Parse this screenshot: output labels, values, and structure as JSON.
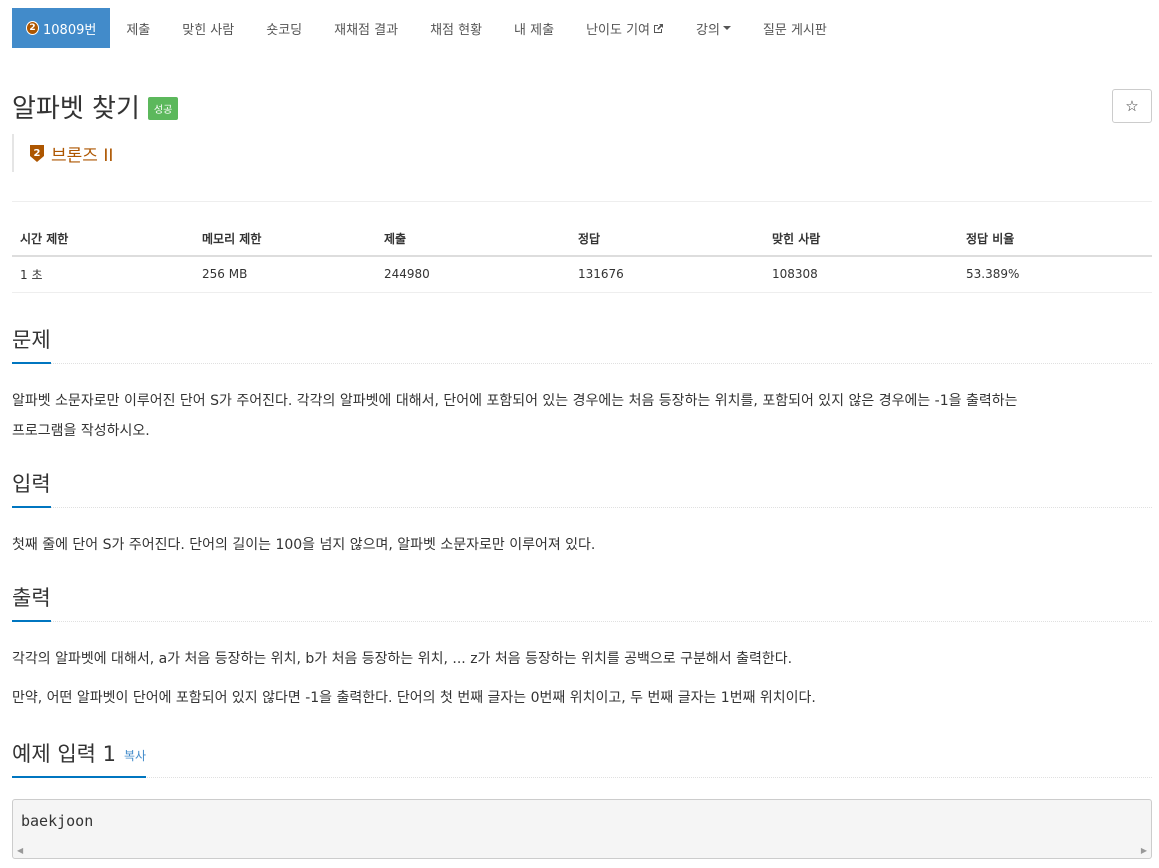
{
  "nav": {
    "problem_tab": {
      "tier": "2",
      "label": "10809번"
    },
    "items": [
      "제출",
      "맞힌 사람",
      "숏코딩",
      "재채점 결과",
      "채점 현황",
      "내 제출",
      "난이도 기여",
      "강의",
      "질문 게시판"
    ]
  },
  "problem": {
    "title": "알파벳 찾기",
    "status": "성공",
    "star": "☆",
    "tier_number": "2",
    "tier_label": "브론즈 II"
  },
  "info_table": {
    "headers": [
      "시간 제한",
      "메모리 제한",
      "제출",
      "정답",
      "맞힌 사람",
      "정답 비율"
    ],
    "row": [
      "1 초",
      "256 MB",
      "244980",
      "131676",
      "108308",
      "53.389%"
    ]
  },
  "sections": {
    "problem_title": "문제",
    "problem_text_1": "알파벳 소문자로만 이루어진 단어 S가 주어진다. 각각의 알파벳에 대해서, 단어에 포함되어 있는 경우에는 처음 등장하는 위치를, 포함되어 있지 않은 경우에는 -1을 출력하는",
    "problem_text_2": "프로그램을 작성하시오.",
    "input_title": "입력",
    "input_text": "첫째 줄에 단어 S가 주어진다. 단어의 길이는 100을 넘지 않으며, 알파벳 소문자로만 이루어져 있다.",
    "output_title": "출력",
    "output_text_1": "각각의 알파벳에 대해서, a가 처음 등장하는 위치, b가 처음 등장하는 위치, ... z가 처음 등장하는 위치를 공백으로 구분해서 출력한다.",
    "output_text_2": "만약, 어떤 알파벳이 단어에 포함되어 있지 않다면 -1을 출력한다. 단어의 첫 번째 글자는 0번째 위치이고, 두 번째 글자는 1번째 위치이다.",
    "sample_title": "예제 입력 1",
    "copy_label": "복사",
    "sample_input": "baekjoon"
  },
  "colors": {
    "nav_active": "#428bca",
    "tier_bronze": "#ad5600",
    "success": "#5cb85c",
    "section_underline": "#0076c0"
  },
  "icons": {
    "external_link": "external-link-icon",
    "dropdown": "caret-down-icon",
    "star": "star-outline-icon"
  }
}
